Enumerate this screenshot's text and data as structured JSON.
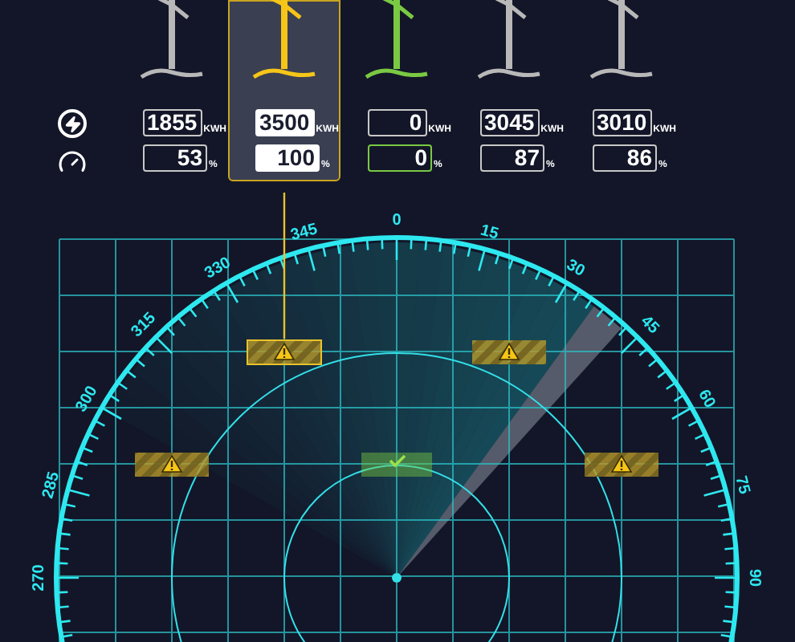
{
  "turbines": [
    {
      "selected": false,
      "kind": "warning",
      "energy": "1855",
      "energy_unit": "KWH",
      "percent": "53",
      "percent_unit": "%"
    },
    {
      "selected": true,
      "kind": "warning",
      "energy": "3500",
      "energy_unit": "KWH",
      "percent": "100",
      "percent_unit": "%"
    },
    {
      "selected": false,
      "kind": "ok",
      "energy": "0",
      "energy_unit": "KWH",
      "percent": "0",
      "percent_unit": "%"
    },
    {
      "selected": false,
      "kind": "warning",
      "energy": "3045",
      "energy_unit": "KWH",
      "percent": "87",
      "percent_unit": "%"
    },
    {
      "selected": false,
      "kind": "warning",
      "energy": "3010",
      "energy_unit": "KWH",
      "percent": "86",
      "percent_unit": "%"
    }
  ],
  "dial_labels": [
    "270",
    "285",
    "300",
    "315",
    "330",
    "345",
    "0",
    "15",
    "30",
    "45",
    "60",
    "75",
    "90"
  ]
}
